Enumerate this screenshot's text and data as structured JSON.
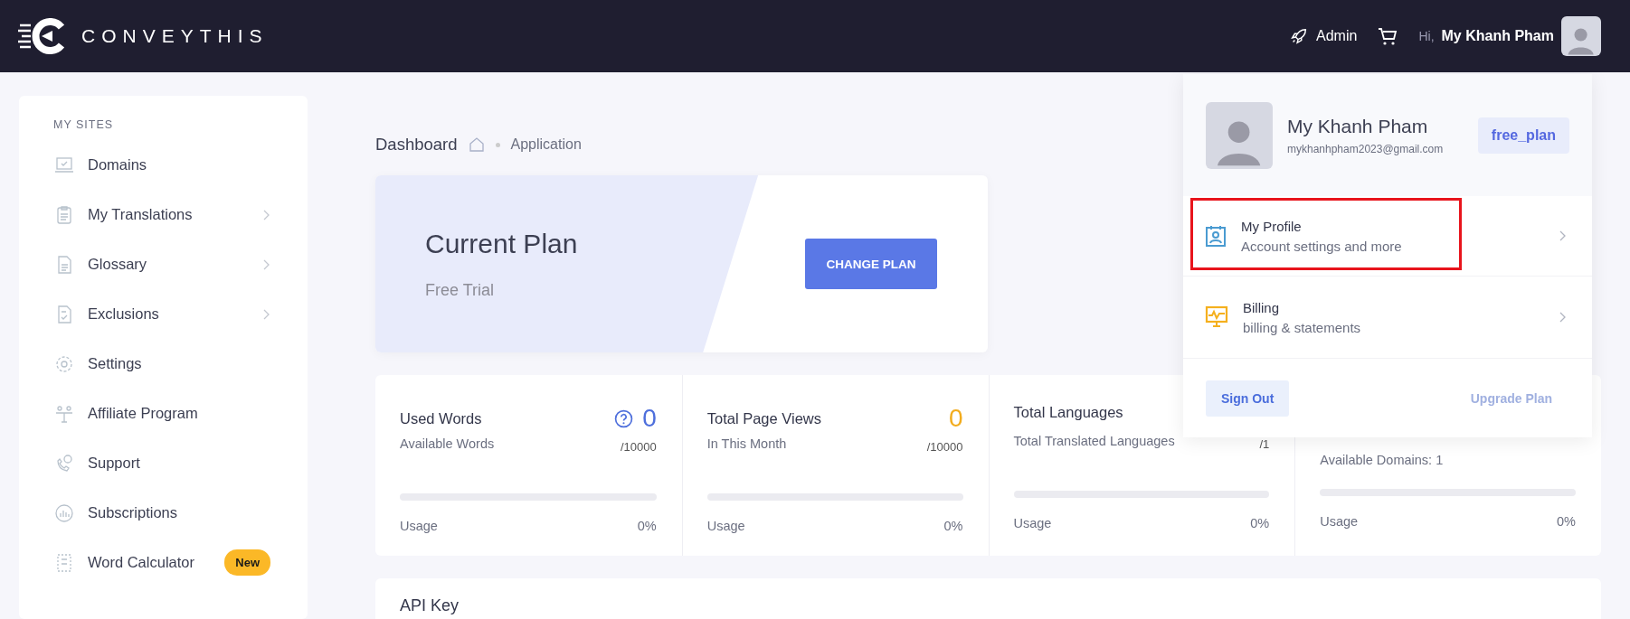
{
  "header": {
    "logo": "CONVEYTHIS",
    "admin_label": "Admin",
    "greeting": "Hi,",
    "user_name": "My Khanh Pham"
  },
  "sidebar": {
    "heading": "MY SITES",
    "items": [
      {
        "label": "Domains",
        "has_children": false
      },
      {
        "label": "My Translations",
        "has_children": true
      },
      {
        "label": "Glossary",
        "has_children": true
      },
      {
        "label": "Exclusions",
        "has_children": true
      },
      {
        "label": "Settings",
        "has_children": false
      },
      {
        "label": "Affiliate Program",
        "has_children": false
      },
      {
        "label": "Support",
        "has_children": false
      },
      {
        "label": "Subscriptions",
        "has_children": false
      },
      {
        "label": "Word Calculator",
        "has_children": false,
        "badge": "New"
      }
    ]
  },
  "breadcrumb": {
    "title": "Dashboard",
    "current": "Application"
  },
  "plan": {
    "title": "Current Plan",
    "subtitle": "Free Trial",
    "button": "CHANGE PLAN"
  },
  "stats": [
    {
      "title": "Used Words",
      "subtitle": "Available Words",
      "value": "0",
      "color": "#4e6fdc",
      "help": true,
      "total": "/10000",
      "usage_label": "Usage",
      "usage_value": "0%",
      "level": 0
    },
    {
      "title": "Total Page Views",
      "subtitle": "In This Month",
      "value": "0",
      "color": "#f2ac1e",
      "help": false,
      "total": "/10000",
      "usage_label": "Usage",
      "usage_value": "0%",
      "level": 0
    },
    {
      "title": "Total Languages",
      "subtitle": "Total Translated Languages",
      "total": "/1",
      "usage_label": "Usage",
      "usage_value": "0%",
      "level": 0
    },
    {
      "subtitle": "Available Domains: 1",
      "usage_label": "Usage",
      "usage_value": "0%",
      "level": 0
    }
  ],
  "api_key": {
    "title": "API Key"
  },
  "user_menu": {
    "name": "My Khanh Pham",
    "email": "mykhanhpham2023@gmail.com",
    "plan_badge": "free_plan",
    "items": [
      {
        "title": "My Profile",
        "subtitle": "Account settings and more",
        "highlighted": true
      },
      {
        "title": "Billing",
        "subtitle": "billing & statements",
        "highlighted": false
      }
    ],
    "sign_out": "Sign Out",
    "upgrade": "Upgrade Plan"
  }
}
